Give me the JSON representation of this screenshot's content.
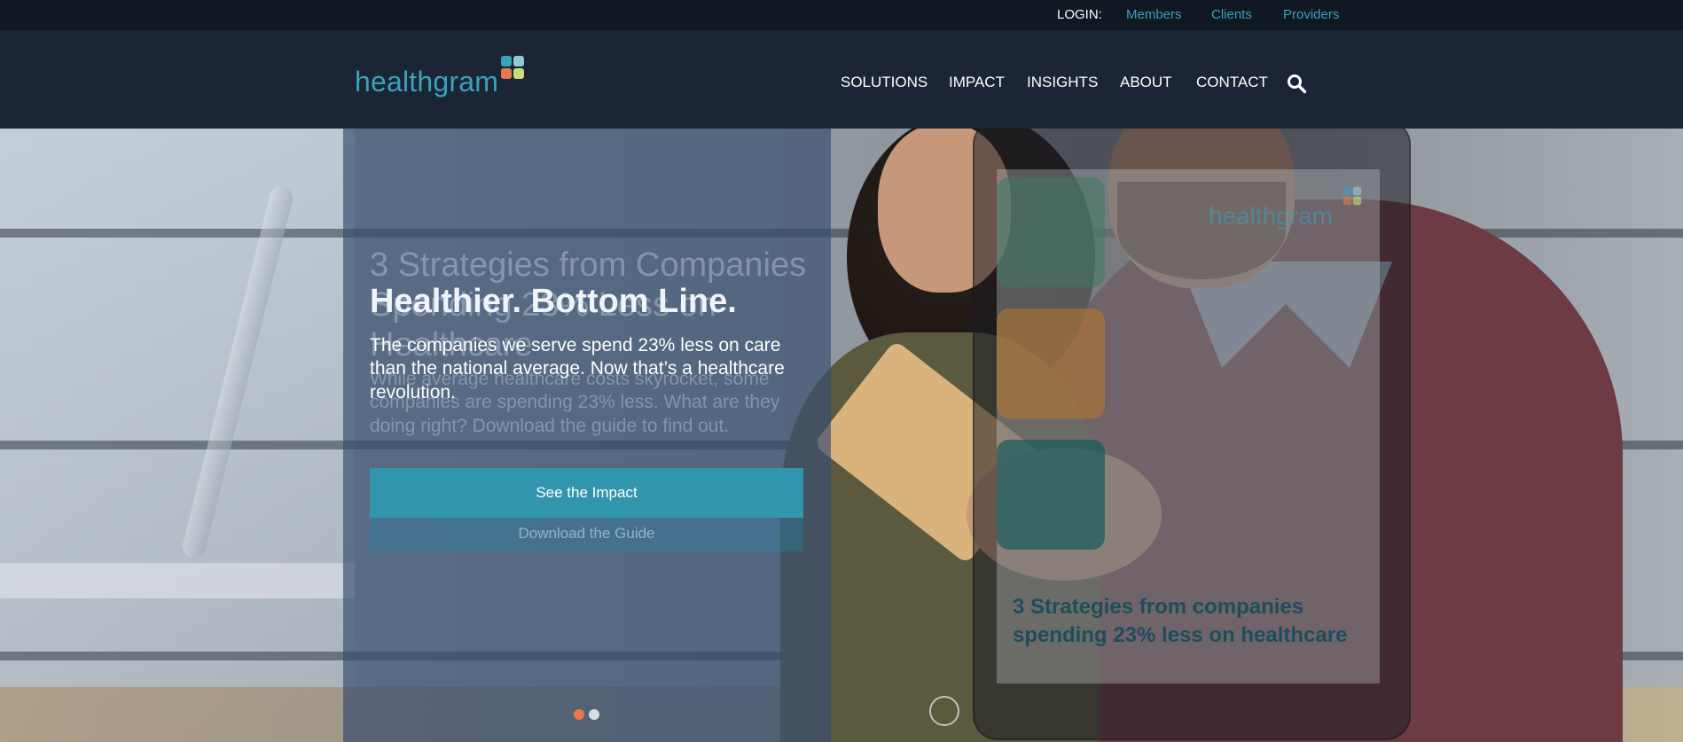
{
  "topbar": {
    "login_label": "LOGIN:",
    "links": [
      "Members",
      "Clients",
      "Providers"
    ]
  },
  "header": {
    "logo_text": "healthgram",
    "nav": [
      "SOLUTIONS",
      "IMPACT",
      "INSIGHTS",
      "ABOUT",
      "CONTACT"
    ],
    "search_icon": "search-icon"
  },
  "hero": {
    "active_slide": {
      "title": "Healthier. Bottom Line.",
      "body": "The companies we serve spend 23% less on care than the national average. Now that’s a healthcare revolution.",
      "cta": "See the Impact"
    },
    "faded_slide": {
      "title": "3 Strategies from Companies Spending 23% Less on Healthcare",
      "body": "While average healthcare costs skyrocket, some companies are spending 23% less. What are they doing right? Download the guide to find out.",
      "cta": "Download the Guide",
      "device_logo": "healthgram",
      "device_caption": "3 Strategies from companies spending 23% less on healthcare"
    },
    "carousel": {
      "slide_count": 2,
      "active_index": 1
    }
  },
  "colors": {
    "brand_teal": "#3aa2bb",
    "topbar_bg": "#101822",
    "header_bg": "#1b2535",
    "cta_bg": "#3196ad",
    "active_dot": "#e8794a",
    "inactive_dot": "#d8dde2"
  }
}
